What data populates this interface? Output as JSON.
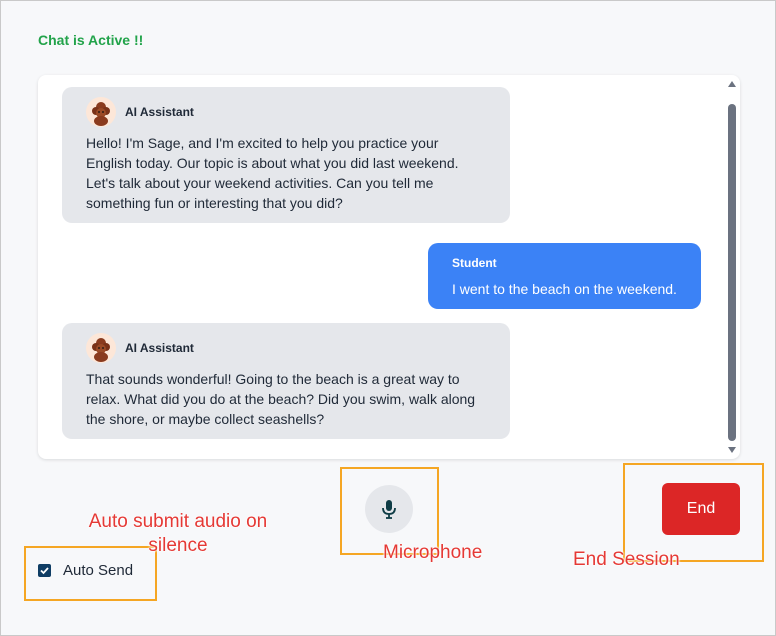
{
  "status_text": "Chat is Active !!",
  "messages": [
    {
      "role": "ai",
      "sender": "AI Assistant",
      "text": "Hello! I'm Sage, and I'm excited to help you practice your English today. Our topic is about what you did last weekend. Let's talk about your weekend activities. Can you tell me something fun or interesting that you did?"
    },
    {
      "role": "student",
      "sender": "Student",
      "text": "I went to the beach on the weekend."
    },
    {
      "role": "ai",
      "sender": "AI Assistant",
      "text": "That sounds wonderful! Going to the beach is a great way to relax. What did you do at the beach? Did you swim, walk along the shore, or maybe collect seashells?"
    }
  ],
  "controls": {
    "mic_icon": "microphone-icon",
    "end_label": "End",
    "auto_send_label": "Auto Send",
    "auto_send_checked": true
  },
  "annotations": {
    "auto_submit": "Auto submit audio on silence",
    "microphone": "Microphone",
    "end_session": "End Session"
  },
  "colors": {
    "status": "#22a34a",
    "ai_bubble": "#e5e7eb",
    "student_bubble": "#3b82f6",
    "end_button": "#dc2626",
    "annotation_box": "#f5a623",
    "annotation_text": "#e53935"
  }
}
